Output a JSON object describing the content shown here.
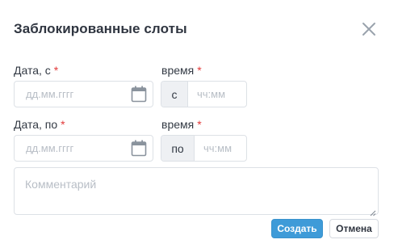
{
  "dialog": {
    "title": "Заблокированные слоты",
    "close_icon": "close-icon"
  },
  "from": {
    "date_label": "Дата, с",
    "time_label": "время",
    "required_mark": "*",
    "date_placeholder": "дд.мм.гггг",
    "time_prefix": "с",
    "time_placeholder": "чч:мм"
  },
  "to": {
    "date_label": "Дата, по",
    "time_label": "время",
    "required_mark": "*",
    "date_placeholder": "дд.мм.гггг",
    "time_prefix": "по",
    "time_placeholder": "чч:мм"
  },
  "comment": {
    "placeholder": "Комментарий"
  },
  "actions": {
    "create_label": "Создать",
    "cancel_label": "Отмена"
  },
  "colors": {
    "primary": "#3e9bd8",
    "required": "#e23a3a",
    "border": "#dde1e6",
    "prefix_bg": "#eef0f3"
  }
}
